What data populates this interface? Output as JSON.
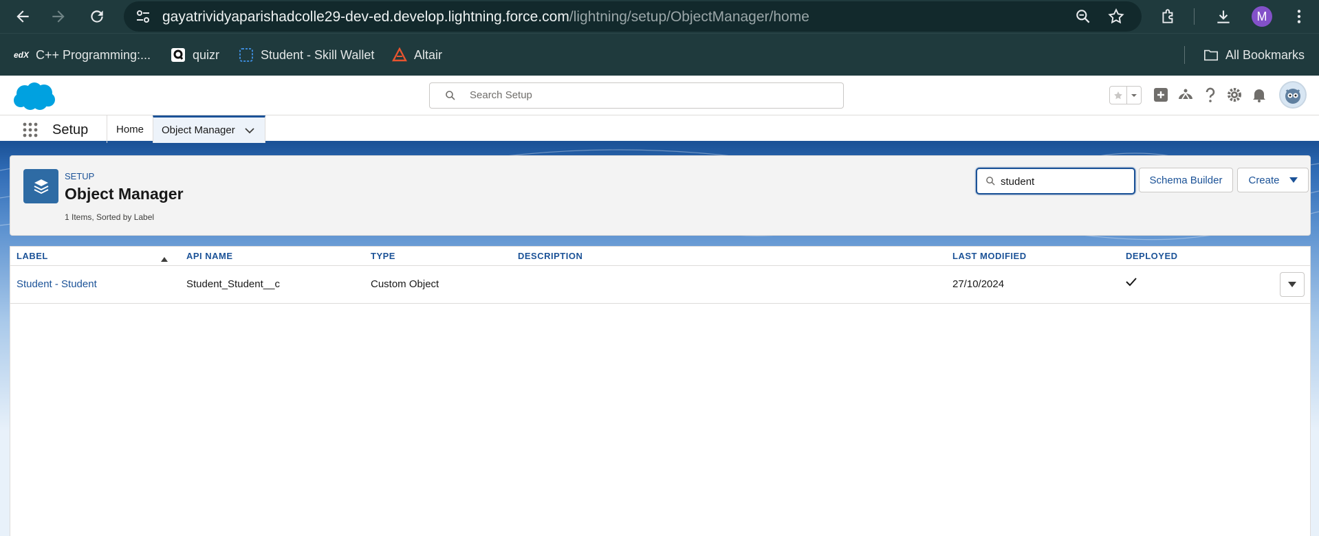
{
  "browser": {
    "url_host": "gayatrividyaparishadcolle29-dev-ed.develop.lightning.force.com",
    "url_path": "/lightning/setup/ObjectManager/home",
    "profile_initial": "M",
    "bookmarks": [
      {
        "label": "C++ Programming:...",
        "icon": "edx-icon"
      },
      {
        "label": "quizr",
        "icon": "quizr-icon"
      },
      {
        "label": "Student - Skill Wallet",
        "icon": "skill-wallet-icon"
      },
      {
        "label": "Altair",
        "icon": "altair-icon"
      }
    ],
    "all_bookmarks_label": "All Bookmarks"
  },
  "header": {
    "search_placeholder": "Search Setup"
  },
  "app_nav": {
    "app_name": "Setup",
    "tabs": [
      {
        "label": "Home"
      },
      {
        "label": "Object Manager"
      }
    ]
  },
  "object_manager": {
    "eyebrow": "SETUP",
    "title": "Object Manager",
    "meta": "1 Items, Sorted by Label",
    "quick_find_value": "student",
    "schema_builder_label": "Schema Builder",
    "create_label": "Create"
  },
  "table": {
    "columns": [
      "LABEL",
      "API NAME",
      "TYPE",
      "DESCRIPTION",
      "LAST MODIFIED",
      "DEPLOYED"
    ],
    "rows": [
      {
        "label": "Student - Student",
        "api_name": "Student_Student__c",
        "type": "Custom Object",
        "description": "",
        "last_modified": "27/10/2024",
        "deployed": true
      }
    ]
  },
  "colors": {
    "browser_bg": "#1f3a3d",
    "sf_blue": "#1b5297",
    "brand_cloud": "#00a1e0",
    "object_icon_bg": "#2e6ba4"
  }
}
